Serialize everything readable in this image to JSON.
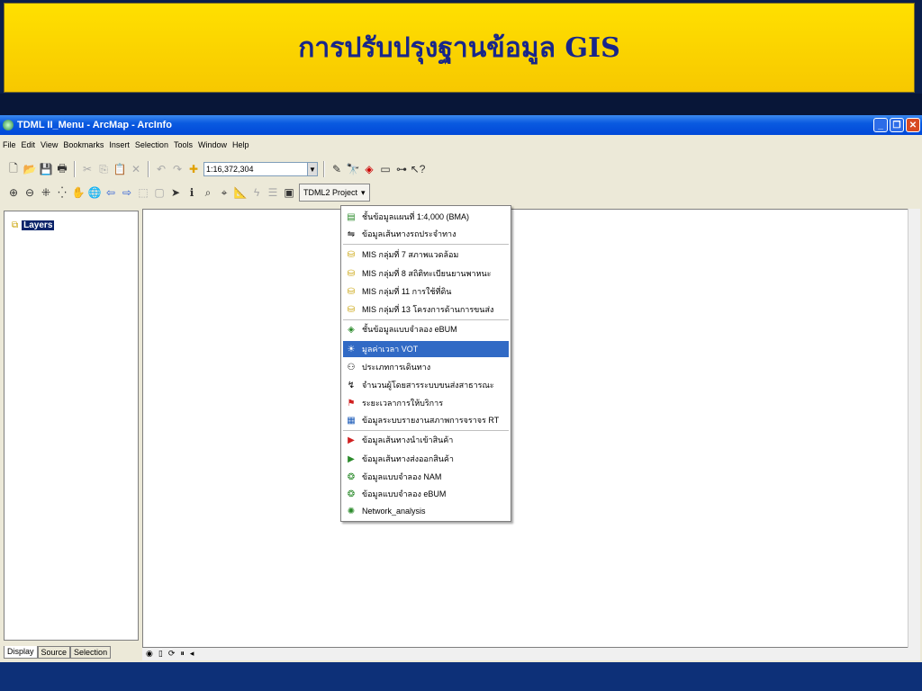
{
  "slide": {
    "title": "การปรับปรุงฐานข้อมูล GIS"
  },
  "window": {
    "title": "TDML II_Menu - ArcMap - ArcInfo",
    "buttons": [
      "_",
      "❐",
      "✕"
    ]
  },
  "menubar": [
    "File",
    "Edit",
    "View",
    "Bookmarks",
    "Insert",
    "Selection",
    "Tools",
    "Window",
    "Help"
  ],
  "toolbar": {
    "scale": "1:16,372,304",
    "project_button": "TDML2 Project"
  },
  "toc": {
    "layers_label": "Layers",
    "tabs": [
      "Display",
      "Source",
      "Selection"
    ]
  },
  "popup_menu": {
    "items": [
      {
        "label": "ชั้นข้อมูลแผนที่ 1:4,000 (BMA)",
        "icon": "globe-stack-icon"
      },
      {
        "label": "ข้อมูลเส้นทางรถประจำทาง",
        "icon": "route-icon"
      },
      {
        "label": "MIS กลุ่มที่ 7 สภาพแวดล้อม",
        "icon": "database-icon"
      },
      {
        "label": "MIS กลุ่มที่ 8 สถิติทะเบียนยานพาหนะ",
        "icon": "database-icon"
      },
      {
        "label": "MIS กลุ่มที่ 11 การใช้ที่ดิน",
        "icon": "database-icon"
      },
      {
        "label": "MIS กลุ่มที่ 13 โครงการด้านการขนส่ง",
        "icon": "database-icon"
      },
      {
        "label": "ชั้นข้อมูลแบบจำลอง eBUM",
        "icon": "layer-icon"
      },
      {
        "label": "มูลค่าเวลา VOT",
        "icon": "vot-icon"
      },
      {
        "label": "ประเภทการเดินทาง",
        "icon": "network-icon"
      },
      {
        "label": "จำนวนผู้โดยสารระบบขนส่งสาธารณะ",
        "icon": "passenger-icon"
      },
      {
        "label": "ระยะเวลาการให้บริการ",
        "icon": "pin-icon"
      },
      {
        "label": "ข้อมูลระบบรายงานสภาพการจราจร RT",
        "icon": "report-icon"
      },
      {
        "label": "ข้อมูลเส้นทางนำเข้าสินค้า",
        "icon": "import-flag-icon"
      },
      {
        "label": "ข้อมูลเส้นทางส่งออกสินค้า",
        "icon": "export-flag-icon"
      },
      {
        "label": "ข้อมูลแบบจำลอง NAM",
        "icon": "model-icon"
      },
      {
        "label": "ข้อมูลแบบจำลอง eBUM",
        "icon": "model-icon"
      },
      {
        "label": "Network_analysis",
        "icon": "network-analysis-icon"
      }
    ],
    "selected_index": 7
  },
  "colors": {
    "banner": "#ffd800",
    "title_text": "#18268a",
    "selection": "#316ac5"
  }
}
